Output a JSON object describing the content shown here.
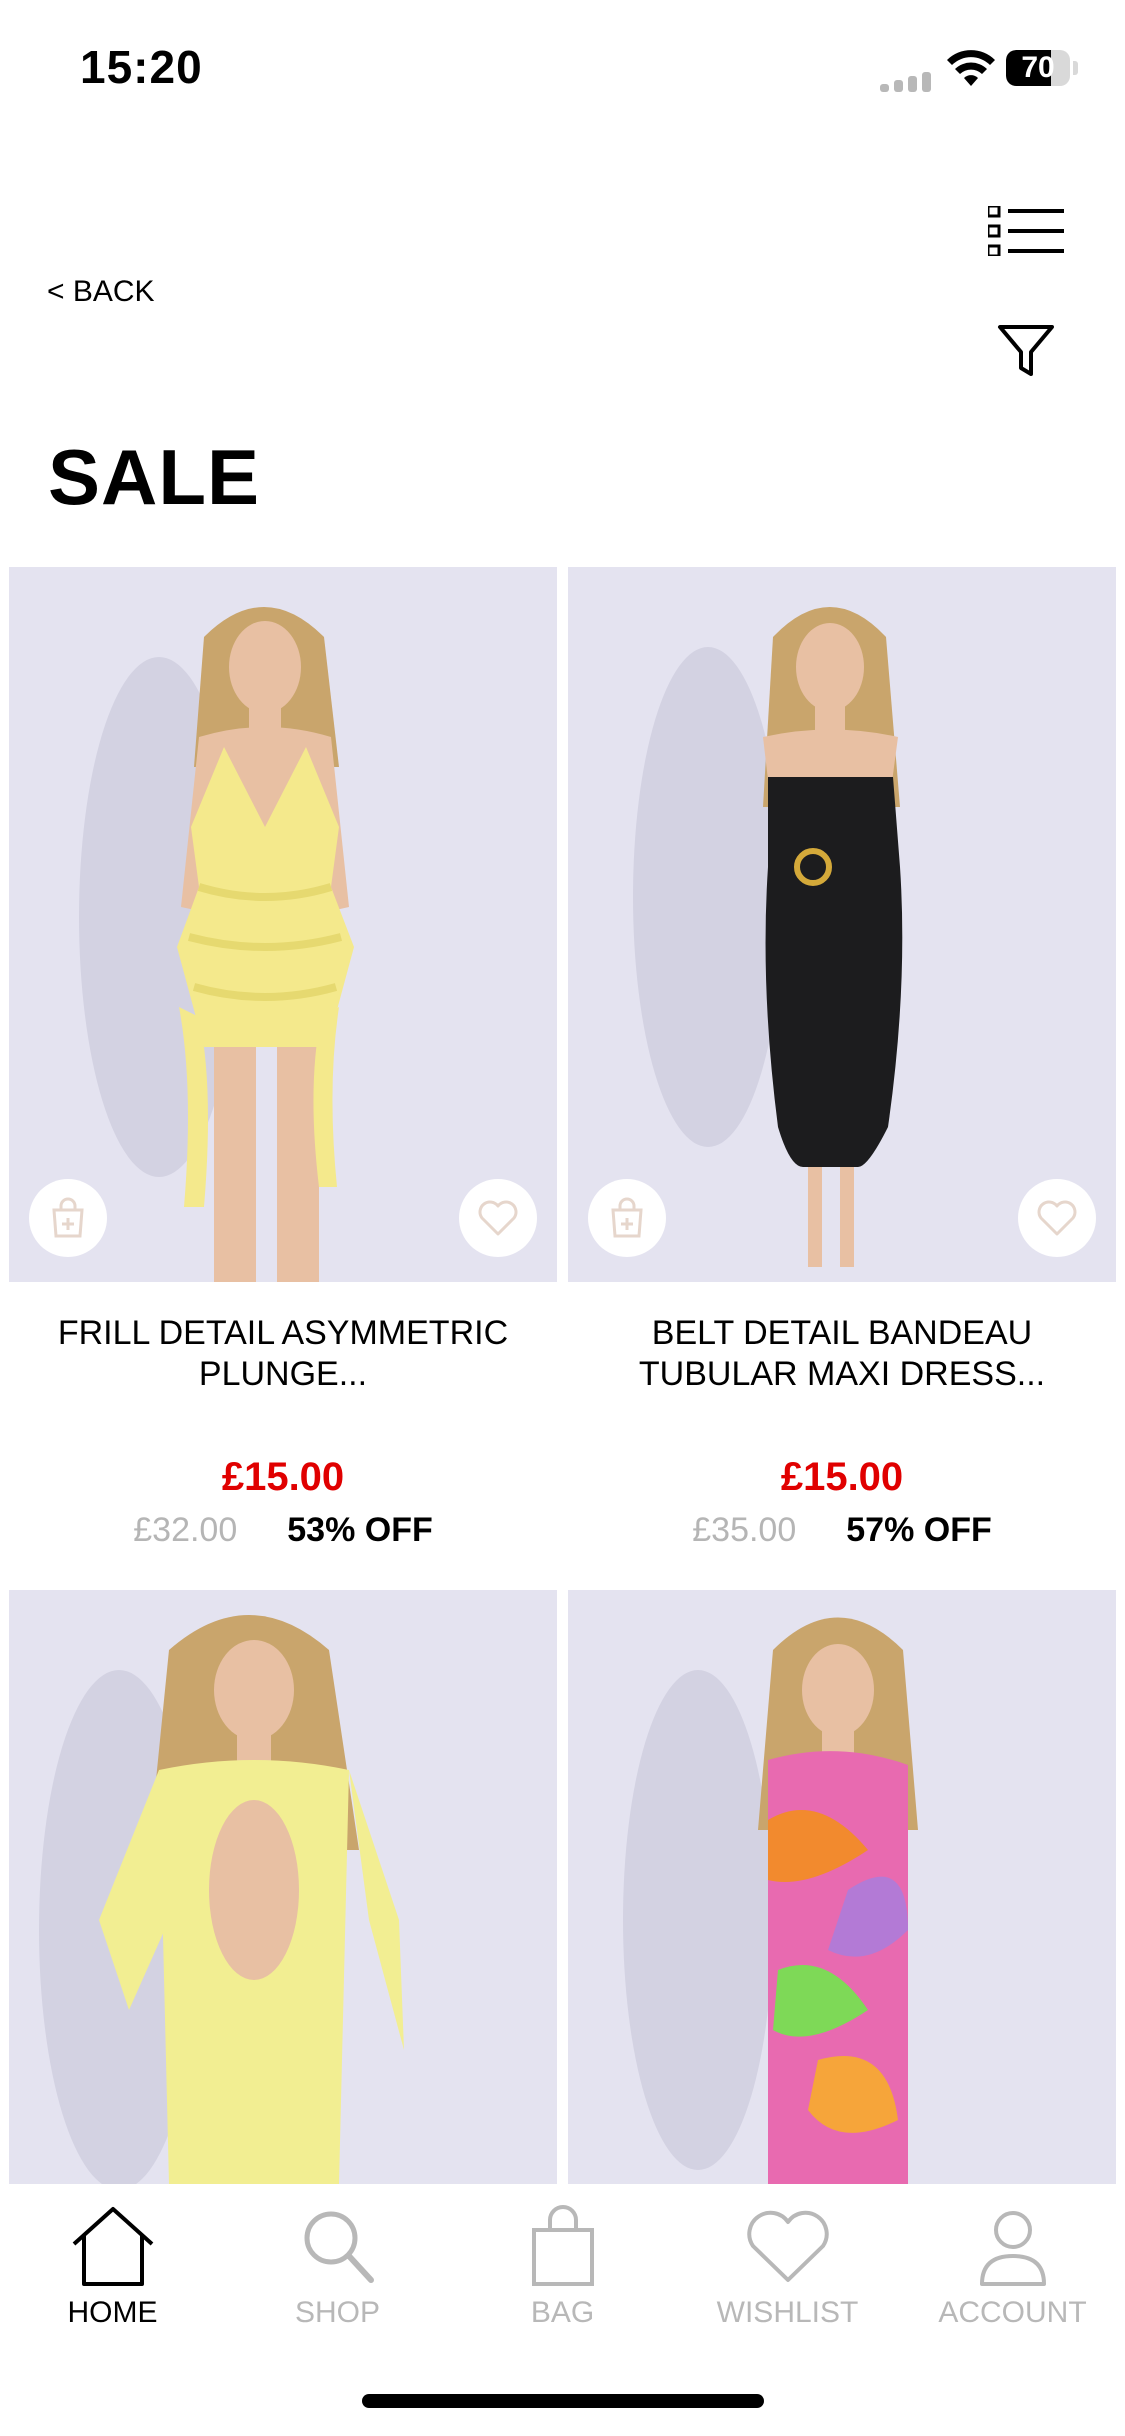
{
  "status_bar": {
    "time": "15:20",
    "battery": "70",
    "battery_level": 0.7
  },
  "header": {
    "back_label": "< BACK",
    "title": "SALE"
  },
  "products": [
    {
      "name": "FRILL DETAIL ASYMMETRIC PLUNGE...",
      "sale_price": "£15.00",
      "original_price": "£32.00",
      "discount": "53% OFF",
      "dress_color": "#f4e98c"
    },
    {
      "name": "BELT DETAIL BANDEAU TUBULAR MAXI DRESS...",
      "sale_price": "£15.00",
      "original_price": "£35.00",
      "discount": "57% OFF",
      "dress_color": "#1c1c1e"
    },
    {
      "name": "",
      "dress_color": "#f2ee92"
    },
    {
      "name": "",
      "dress_color": "#e86ab0"
    }
  ],
  "tab_bar": {
    "items": [
      {
        "label": "HOME",
        "icon": "home-icon",
        "active": true
      },
      {
        "label": "SHOP",
        "icon": "search-icon",
        "active": false
      },
      {
        "label": "BAG",
        "icon": "bag-icon",
        "active": false
      },
      {
        "label": "WISHLIST",
        "icon": "heart-icon",
        "active": false
      },
      {
        "label": "ACCOUNT",
        "icon": "account-icon",
        "active": false
      }
    ]
  },
  "colors": {
    "sale_red": "#e00000",
    "muted_grey": "#b8b8b8",
    "image_bg": "#e4e3f0",
    "icon_beige": "#e6d6cc"
  }
}
